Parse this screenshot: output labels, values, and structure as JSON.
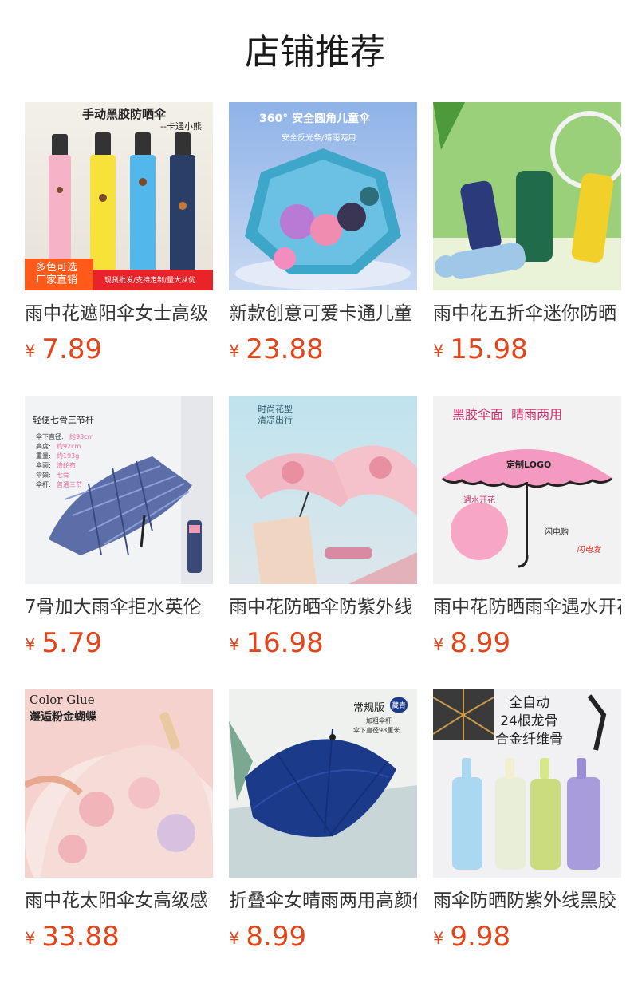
{
  "header": {
    "title": "店铺推荐"
  },
  "currency": "¥",
  "products": [
    {
      "name": "雨中花遮阳伞女士高级",
      "price": "7.89",
      "image_text": {
        "title": "手动黑胶防晒伞",
        "subtitle": "--卡通小熊",
        "badge": "多色可选\n厂家直销",
        "bar": "现货批发/支持定制/量大从优"
      }
    },
    {
      "name": "新款创意可爱卡通儿童",
      "price": "23.88",
      "image_text": {
        "title": "360° 安全圆角儿童伞",
        "subtitle": "安全反光条/晴雨两用"
      }
    },
    {
      "name": "雨中花五折伞迷你防晒",
      "price": "15.98",
      "image_text": {}
    },
    {
      "name": "7骨加大雨伞拒水英伦",
      "price": "5.79",
      "image_text": {
        "title": "轻便七骨三节杆",
        "spec_labels": [
          "伞下直径:",
          "高度:",
          "重量:",
          "伞面:",
          "伞架:",
          "伞杆:"
        ],
        "spec_values": [
          "约93cm",
          "约92cm",
          "约193g",
          "涤纶布",
          "七骨",
          "普通三节"
        ]
      }
    },
    {
      "name": "雨中花防晒伞防紫外线",
      "price": "16.98",
      "image_text": {
        "title": "时尚花型\n清凉出行"
      }
    },
    {
      "name": "雨中花防晒雨伞遇水开花",
      "price": "8.99",
      "image_text": {
        "title": "黑胶伞面  晴雨两用",
        "logo": "定制LOGO",
        "label1": "遇水开花",
        "label2": "闪电购",
        "label3": "闪电发"
      }
    },
    {
      "name": "雨中花太阳伞女高级感",
      "price": "33.88",
      "image_text": {
        "title": "Color Glue",
        "subtitle": "邂逅粉金蝴蝶"
      }
    },
    {
      "name": "折叠伞女晴雨两用高颜值",
      "price": "8.99",
      "image_text": {
        "title": "常规版",
        "seal": "藏青",
        "line1": "加粗伞杆",
        "line2": "伞下直径98厘米"
      }
    },
    {
      "name": "雨伞防晒防紫外线黑胶",
      "price": "9.98",
      "image_text": {
        "title": "全自动\n24根龙骨\n合金纤维骨"
      }
    }
  ]
}
